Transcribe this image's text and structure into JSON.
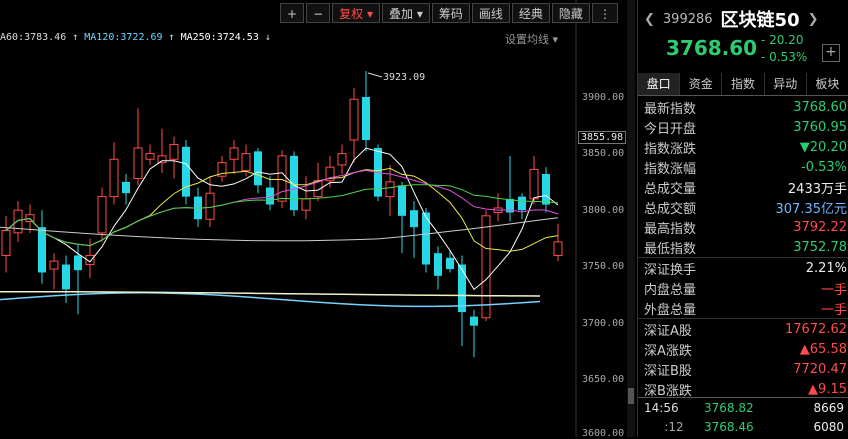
{
  "toolbar": {
    "buttons": [
      "+",
      "−",
      "复权",
      "叠加",
      "筹码",
      "画线",
      "经典",
      "隐藏"
    ],
    "more_icon": "ellipsis-vertical-icon"
  },
  "ma_legend": [
    {
      "text": "A60:3783.46",
      "color": "#dcdcdc"
    },
    {
      "text": "MA120:3722.69",
      "color": "#6fd4ff"
    },
    {
      "text": "MA250:3724.53",
      "color": "#ffffff"
    }
  ],
  "ma_setting": "设置均线",
  "price_axis": [
    "3900.00",
    "3850.00",
    "3800.00",
    "3750.00",
    "3700.00",
    "3650.00",
    "3600.00"
  ],
  "current_price_label": "3855.98",
  "peak_label": "3923.09",
  "chart_data": {
    "type": "candlestick",
    "ylim": [
      3600,
      3960
    ],
    "candles": [
      {
        "o": 3760,
        "c": 3782,
        "h": 3795,
        "l": 3745,
        "d": "up"
      },
      {
        "o": 3780,
        "c": 3800,
        "h": 3808,
        "l": 3772,
        "d": "up"
      },
      {
        "o": 3790,
        "c": 3796,
        "h": 3805,
        "l": 3780,
        "d": "up"
      },
      {
        "o": 3785,
        "c": 3745,
        "h": 3800,
        "l": 3735,
        "d": "down"
      },
      {
        "o": 3748,
        "c": 3755,
        "h": 3762,
        "l": 3730,
        "d": "up"
      },
      {
        "o": 3730,
        "c": 3752,
        "h": 3760,
        "l": 3718,
        "d": "down"
      },
      {
        "o": 3747,
        "c": 3760,
        "h": 3770,
        "l": 3708,
        "d": "down"
      },
      {
        "o": 3752,
        "c": 3760,
        "h": 3775,
        "l": 3740,
        "d": "up"
      },
      {
        "o": 3780,
        "c": 3812,
        "h": 3820,
        "l": 3772,
        "d": "up"
      },
      {
        "o": 3812,
        "c": 3845,
        "h": 3860,
        "l": 3805,
        "d": "up"
      },
      {
        "o": 3815,
        "c": 3825,
        "h": 3832,
        "l": 3805,
        "d": "down"
      },
      {
        "o": 3828,
        "c": 3855,
        "h": 3890,
        "l": 3822,
        "d": "up"
      },
      {
        "o": 3850,
        "c": 3845,
        "h": 3858,
        "l": 3840,
        "d": "up"
      },
      {
        "o": 3842,
        "c": 3848,
        "h": 3872,
        "l": 3833,
        "d": "up"
      },
      {
        "o": 3858,
        "c": 3845,
        "h": 3865,
        "l": 3828,
        "d": "up"
      },
      {
        "o": 3856,
        "c": 3812,
        "h": 3862,
        "l": 3805,
        "d": "down"
      },
      {
        "o": 3812,
        "c": 3792,
        "h": 3820,
        "l": 3785,
        "d": "down"
      },
      {
        "o": 3792,
        "c": 3815,
        "h": 3830,
        "l": 3785,
        "d": "up"
      },
      {
        "o": 3830,
        "c": 3842,
        "h": 3848,
        "l": 3825,
        "d": "up"
      },
      {
        "o": 3845,
        "c": 3855,
        "h": 3862,
        "l": 3832,
        "d": "up"
      },
      {
        "o": 3850,
        "c": 3835,
        "h": 3858,
        "l": 3830,
        "d": "up"
      },
      {
        "o": 3852,
        "c": 3822,
        "h": 3855,
        "l": 3815,
        "d": "down"
      },
      {
        "o": 3820,
        "c": 3805,
        "h": 3830,
        "l": 3800,
        "d": "down"
      },
      {
        "o": 3808,
        "c": 3848,
        "h": 3853,
        "l": 3802,
        "d": "up"
      },
      {
        "o": 3848,
        "c": 3800,
        "h": 3852,
        "l": 3795,
        "d": "down"
      },
      {
        "o": 3800,
        "c": 3810,
        "h": 3830,
        "l": 3792,
        "d": "up"
      },
      {
        "o": 3812,
        "c": 3826,
        "h": 3842,
        "l": 3808,
        "d": "up"
      },
      {
        "o": 3826,
        "c": 3838,
        "h": 3848,
        "l": 3820,
        "d": "up"
      },
      {
        "o": 3840,
        "c": 3850,
        "h": 3858,
        "l": 3832,
        "d": "up"
      },
      {
        "o": 3862,
        "c": 3898,
        "h": 3908,
        "l": 3842,
        "d": "up"
      },
      {
        "o": 3900,
        "c": 3862,
        "h": 3923,
        "l": 3852,
        "d": "down"
      },
      {
        "o": 3855,
        "c": 3812,
        "h": 3858,
        "l": 3808,
        "d": "down"
      },
      {
        "o": 3812,
        "c": 3825,
        "h": 3840,
        "l": 3795,
        "d": "up"
      },
      {
        "o": 3822,
        "c": 3795,
        "h": 3825,
        "l": 3762,
        "d": "down"
      },
      {
        "o": 3800,
        "c": 3785,
        "h": 3808,
        "l": 3758,
        "d": "down"
      },
      {
        "o": 3798,
        "c": 3752,
        "h": 3802,
        "l": 3745,
        "d": "down"
      },
      {
        "o": 3762,
        "c": 3742,
        "h": 3768,
        "l": 3730,
        "d": "down"
      },
      {
        "o": 3758,
        "c": 3748,
        "h": 3765,
        "l": 3745,
        "d": "down"
      },
      {
        "o": 3752,
        "c": 3710,
        "h": 3760,
        "l": 3680,
        "d": "down"
      },
      {
        "o": 3706,
        "c": 3698,
        "h": 3712,
        "l": 3670,
        "d": "down"
      },
      {
        "o": 3705,
        "c": 3795,
        "h": 3800,
        "l": 3702,
        "d": "up"
      },
      {
        "o": 3798,
        "c": 3802,
        "h": 3815,
        "l": 3790,
        "d": "up"
      },
      {
        "o": 3798,
        "c": 3810,
        "h": 3848,
        "l": 3790,
        "d": "down"
      },
      {
        "o": 3800,
        "c": 3812,
        "h": 3815,
        "l": 3792,
        "d": "down"
      },
      {
        "o": 3810,
        "c": 3836,
        "h": 3848,
        "l": 3805,
        "d": "up"
      },
      {
        "o": 3832,
        "c": 3805,
        "h": 3838,
        "l": 3798,
        "d": "down"
      },
      {
        "o": 3772,
        "c": 3760,
        "h": 3788,
        "l": 3755,
        "d": "up"
      }
    ]
  },
  "quote": {
    "code": "399286",
    "name": "区块链50",
    "price": "3768.60",
    "change": "- 20.20",
    "change_pct": "- 0.53%"
  },
  "tabs": [
    "盘口",
    "资金",
    "指数",
    "异动",
    "板块"
  ],
  "rows_group1": [
    {
      "k": "最新指数",
      "v": "3768.60",
      "cls": "g"
    },
    {
      "k": "今日开盘",
      "v": "3760.95",
      "cls": "g"
    },
    {
      "k": "指数涨跌",
      "v": "▼20.20",
      "cls": "g"
    },
    {
      "k": "指数涨幅",
      "v": "-0.53%",
      "cls": "g"
    },
    {
      "k": "总成交量",
      "v": "2433万手",
      "cls": "w"
    },
    {
      "k": "总成交额",
      "v": "307.35亿元",
      "cls": "b"
    },
    {
      "k": "最高指数",
      "v": "3792.22",
      "cls": "r"
    },
    {
      "k": "最低指数",
      "v": "3752.78",
      "cls": "g"
    }
  ],
  "rows_group2": [
    {
      "k": "深证换手",
      "v": "2.21%",
      "cls": "w"
    },
    {
      "k": "内盘总量",
      "v": "一手",
      "cls": "r"
    },
    {
      "k": "外盘总量",
      "v": "一手",
      "cls": "r"
    }
  ],
  "rows_group3": [
    {
      "k": "深证A股",
      "v": "17672.62",
      "cls": "r"
    },
    {
      "k": "深A涨跌",
      "v": "▲65.58",
      "cls": "r"
    },
    {
      "k": "深证B股",
      "v": "7720.47",
      "cls": "r"
    },
    {
      "k": "深B涨跌",
      "v": "▲9.15",
      "cls": "r"
    }
  ],
  "ticks": [
    {
      "time": "14:56",
      "price": "3768.82",
      "vol": "8669"
    },
    {
      "time": ":12",
      "price": "3768.46",
      "vol": "6080"
    }
  ]
}
